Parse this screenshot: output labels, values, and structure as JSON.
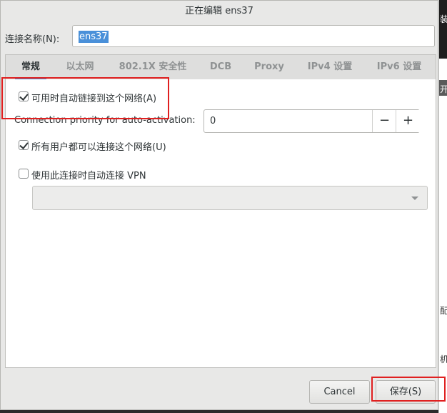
{
  "dialog": {
    "title": "正在编辑 ens37",
    "connection_name_label": "连接名称(N):",
    "connection_name_value": "ens37"
  },
  "tabs": [
    {
      "label": "常规",
      "active": true
    },
    {
      "label": "以太网",
      "active": false
    },
    {
      "label": "802.1X 安全性",
      "active": false
    },
    {
      "label": "DCB",
      "active": false
    },
    {
      "label": "Proxy",
      "active": false
    },
    {
      "label": "IPv4 设置",
      "active": false
    },
    {
      "label": "IPv6 设置",
      "active": false
    }
  ],
  "general": {
    "auto_connect": {
      "label": "可用时自动链接到这个网络(A)",
      "checked": true
    },
    "priority_label": "Connection priority for auto-activation:",
    "priority_value": "0",
    "decrement_symbol": "−",
    "increment_symbol": "+",
    "all_users": {
      "label": "所有用户都可以连接这个网络(U)",
      "checked": true
    },
    "auto_vpn": {
      "label": "使用此连接时自动连接 VPN",
      "checked": false
    },
    "vpn_select_value": ""
  },
  "footer": {
    "cancel_label": "Cancel",
    "save_label": "保存(S)"
  },
  "background_fragments": [
    "装",
    "开",
    "配置",
    "机"
  ],
  "colors": {
    "accent": "#4a90d9",
    "highlight_box": "#e02020"
  }
}
